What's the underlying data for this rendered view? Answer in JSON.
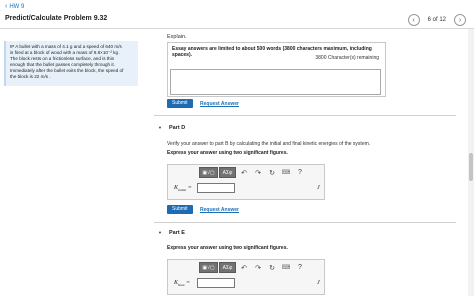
{
  "nav": {
    "back_label": "HW 9"
  },
  "header": {
    "title": "Predict/Calculate Problem 9.32"
  },
  "pager": {
    "text": "6 of 12",
    "prev_icon": "‹",
    "next_icon": "›"
  },
  "problem": {
    "line1": "IP A bullet with a mass of 4.1 g and a speed of 640 m/s",
    "line2": "is fired at a block of wood with a mass of 9.8×10⁻² kg .",
    "line3": "The block rests on a frictionless surface, and is thin",
    "line4": "enough that the bullet passes completely through it.",
    "line5": "Immediately after the bullet exits the block, the speed of",
    "line6": "the block is 22 m/s ."
  },
  "explain": {
    "label": "Explain.",
    "note": "Essay answers are limited to about 500 words (3800 characters maximum, including spaces).",
    "remaining": "3800 Character(s) remaining"
  },
  "actions": {
    "submit": "Submit",
    "request": "Request Answer"
  },
  "part_d": {
    "title": "Part D",
    "instruction": "Verify your answer to part B by calculating the initial and final kinetic energies of the system.",
    "sig_figs": "Express your answer using two significant figures.",
    "var": "K",
    "var_sub": "initial",
    "equals": "=",
    "unit": "J"
  },
  "part_e": {
    "title": "Part E",
    "sig_figs": "Express your answer using two significant figures.",
    "var": "K",
    "var_sub": "final",
    "equals": "=",
    "unit": "J"
  },
  "toolbar": {
    "math_label": "▣√▢",
    "greek_label": "ΑΣφ",
    "undo": "↶",
    "redo": "↷",
    "reset": "↻",
    "keyboard": "⌨",
    "help": "?"
  },
  "colors": {
    "accent": "#1d6cb3",
    "link": "#1b6fb5",
    "sidebar_bg": "#e8f1f9",
    "toolbar_btn": "#727272"
  }
}
